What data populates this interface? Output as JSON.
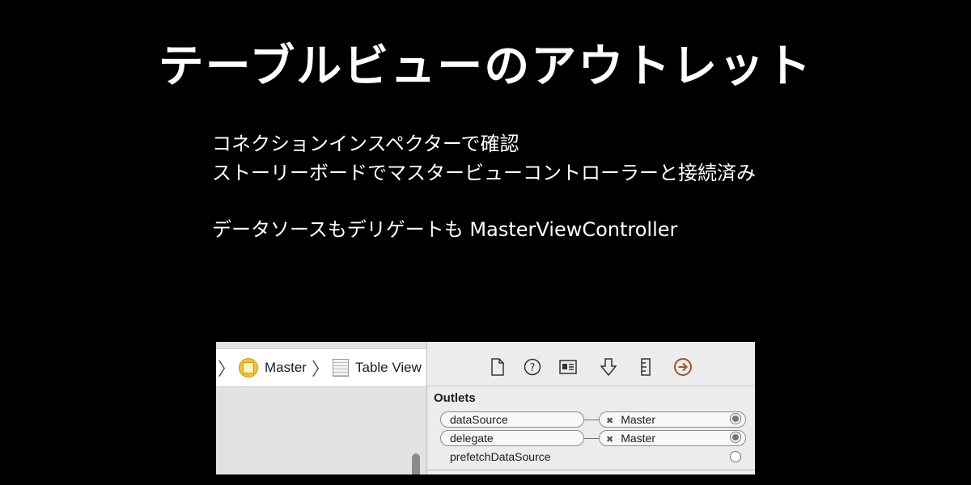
{
  "slide": {
    "title": "テーブルビューのアウトレット",
    "bullets": [
      "コネクションインスペクターで確認",
      "ストーリーボードでマスタービューコントローラーと接続済み",
      "データソースもデリゲートも MasterViewController"
    ]
  },
  "xcode": {
    "jumpbar": {
      "master_label": "Master",
      "table_view_label": "Table View"
    },
    "inspector": {
      "toolbar_icons": [
        "file-inspector-icon",
        "quick-help-icon",
        "identity-inspector-icon",
        "attributes-inspector-icon",
        "size-inspector-icon",
        "connections-inspector-icon"
      ],
      "accent_color": "#a0522d",
      "section_title": "Outlets",
      "outlets": [
        {
          "name": "dataSource",
          "target": "Master",
          "connected": true
        },
        {
          "name": "delegate",
          "target": "Master",
          "connected": true
        },
        {
          "name": "prefetchDataSource",
          "target": "",
          "connected": false
        }
      ],
      "disconnect_glyph": "✖"
    }
  }
}
